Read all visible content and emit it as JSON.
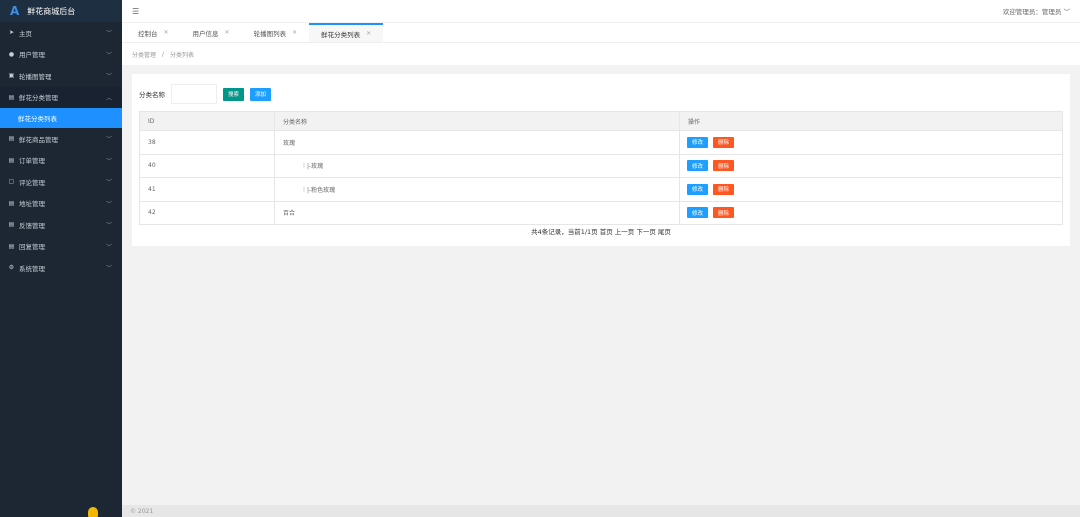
{
  "app": {
    "logo_mark": "A",
    "title": "鲜花商城后台"
  },
  "sidebar": {
    "items": [
      {
        "icon": "send-icon",
        "glyph": "➤",
        "label": "主页"
      },
      {
        "icon": "user-icon",
        "glyph": "●",
        "label": "用户管理"
      },
      {
        "icon": "image-icon",
        "glyph": "▣",
        "label": "轮播图管理"
      },
      {
        "icon": "folder-icon",
        "glyph": "▤",
        "label": "鲜花分类管理"
      },
      {
        "icon": "folder-icon",
        "glyph": "▤",
        "label": "鲜花商品管理"
      },
      {
        "icon": "order-icon",
        "glyph": "▤",
        "label": "订单管理"
      },
      {
        "icon": "comment-icon",
        "glyph": "▢",
        "label": "评论管理"
      },
      {
        "icon": "address-icon",
        "glyph": "▤",
        "label": "地址管理"
      },
      {
        "icon": "feedback-icon",
        "glyph": "▤",
        "label": "反馈管理"
      },
      {
        "icon": "reply-icon",
        "glyph": "▤",
        "label": "回复管理"
      },
      {
        "icon": "gear-icon",
        "glyph": "⚙",
        "label": "系统管理"
      }
    ],
    "sub_active": "鲜花分类列表"
  },
  "header": {
    "toggle_glyph": "☰",
    "welcome": "欢迎管理员：管理员 ﹀"
  },
  "tabs": [
    {
      "label": "控制台"
    },
    {
      "label": "用户信息"
    },
    {
      "label": "轮播图列表"
    },
    {
      "label": "鲜花分类列表",
      "active": true
    }
  ],
  "breadcrumb": {
    "parent": "分类管理",
    "separator": "/",
    "current": "分类列表"
  },
  "search": {
    "label": "分类名称",
    "value": "",
    "search_button": "搜索",
    "add_button": "添加"
  },
  "table": {
    "columns": [
      "ID",
      "分类名称",
      "操作"
    ],
    "rows": [
      {
        "id": "38",
        "name": "玫瑰"
      },
      {
        "id": "40",
        "name": "｜|-玫瑰"
      },
      {
        "id": "41",
        "name": "｜|-粉色玫瑰"
      },
      {
        "id": "42",
        "name": "百合"
      }
    ],
    "edit_label": "修改",
    "delete_label": "删除"
  },
  "pagination": {
    "text": "共4条记录，当前1/1页 首页 上一页 下一页 尾页"
  },
  "footer": {
    "copyright": "© 2021"
  },
  "colors": {
    "sidebar_bg": "#1c2733",
    "accent": "#1e90ff",
    "search_btn": "#009688",
    "delete_btn": "#ff5722"
  }
}
